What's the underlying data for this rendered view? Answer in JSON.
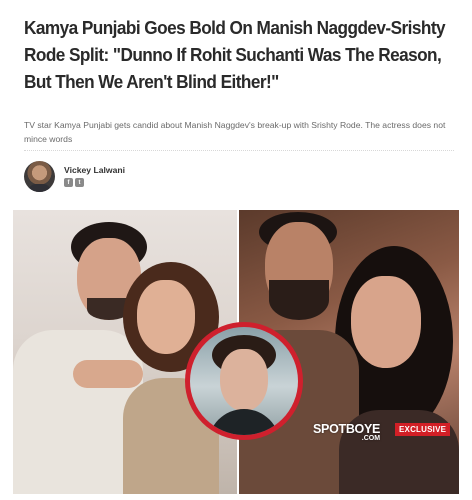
{
  "article": {
    "headline": "Kamya Punjabi Goes Bold On Manish Naggdev-Srishty Rode Split: \"Dunno If Rohit Suchanti Was The Reason, But Then We Aren't Blind Either!\"",
    "standfirst": "TV star Kamya Punjabi gets candid about Manish Naggdev's break-up with Srishty Rode. The actress does not mince words"
  },
  "author": {
    "name": "Vickey Lalwani",
    "avatar_icon": "author-avatar",
    "social_icons": [
      "facebook-icon",
      "twitter-icon"
    ]
  },
  "hero_image": {
    "brand_main": "SPOTBOYE",
    "brand_sub": ".COM",
    "badge": "EXCLUSIVE",
    "badge_color": "#d21f26",
    "ring_color": "#cf202d"
  }
}
